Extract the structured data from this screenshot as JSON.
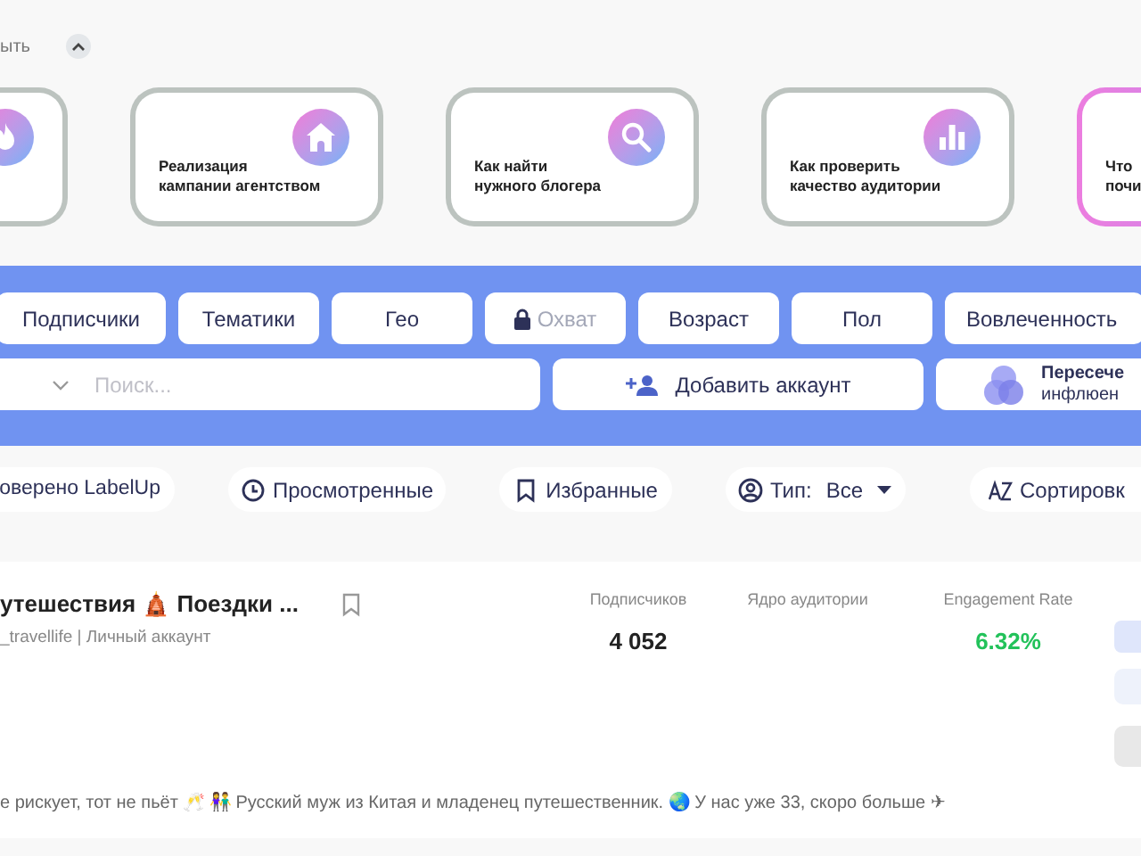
{
  "collapse_toggle": {
    "label": "ыть",
    "expanded": true
  },
  "guide_cards": [
    {
      "selected": false
    },
    {
      "lines": [
        "Реализация",
        "кампании агентством"
      ],
      "selected": false
    },
    {
      "lines": [
        "Как найти",
        "нужного блогера"
      ],
      "selected": false
    },
    {
      "lines": [
        "Как проверить",
        "качество аудитории"
      ],
      "selected": false
    },
    {
      "lines": [
        "Что",
        "почи"
      ],
      "selected": true
    }
  ],
  "filters": [
    {
      "label": "Подписчики",
      "locked": false
    },
    {
      "label": "Тематики",
      "locked": false
    },
    {
      "label": "Гео",
      "locked": false
    },
    {
      "label": "Охват",
      "locked": true
    },
    {
      "label": "Возраст",
      "locked": false
    },
    {
      "label": "Пол",
      "locked": false
    },
    {
      "label": "Вовлеченность",
      "locked": false
    }
  ],
  "search": {
    "placeholder": "Поиск..."
  },
  "add_account": {
    "label": "Добавить аккаунт"
  },
  "intersection": {
    "title": "Пересече",
    "subtitle": "инфлюен"
  },
  "toolbar": [
    {
      "kind": "pill",
      "label": "оверено LabelUp"
    },
    {
      "kind": "pill",
      "label": "Просмотренные"
    },
    {
      "kind": "pill",
      "label": "Избранные"
    },
    {
      "kind": "dropdown",
      "label": "Тип:",
      "value": "Все"
    },
    {
      "kind": "pill",
      "label": "Сортировк"
    }
  ],
  "account": {
    "title": "утешествия 🛕 Поездки ...",
    "handle": "_travellife | Личный аккаунт",
    "bookmarked": false,
    "stats": [
      {
        "label": "Подписчиков",
        "value": "4 052",
        "kind": "plain"
      },
      {
        "label": "Ядро аудитории"
      },
      {
        "label": "Engagement Rate",
        "value": "6.32%",
        "kind": "positive"
      }
    ],
    "bio": "е рискует, тот не пьёт 🥂 👫 Русский муж из Китая и младенец путешественник. 🌏 У нас уже 33, скоро больше ✈"
  }
}
